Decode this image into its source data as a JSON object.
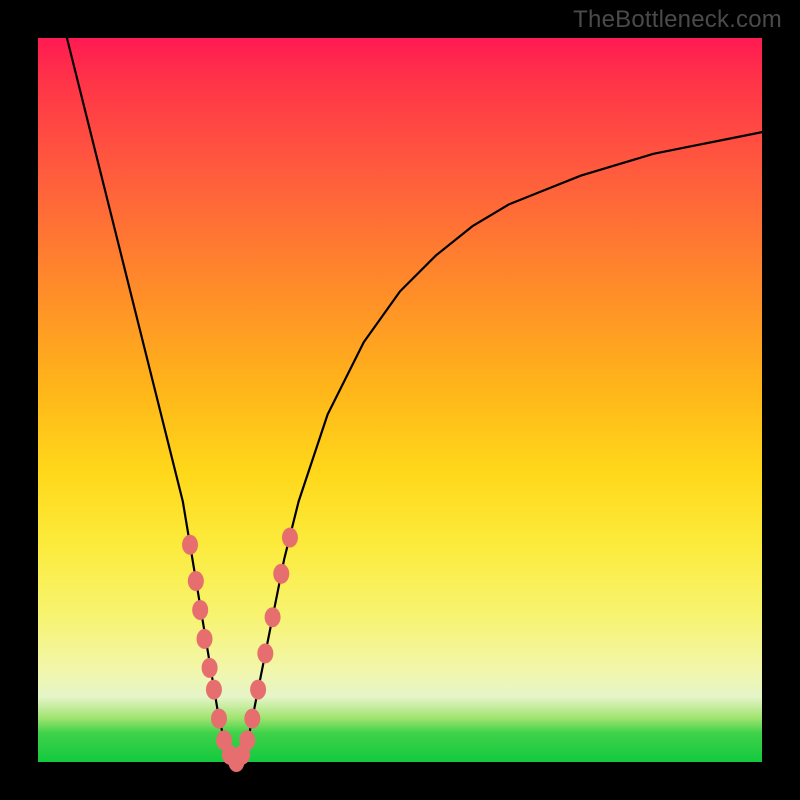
{
  "watermark": "TheBottleneck.com",
  "colors": {
    "frame": "#000000",
    "curve_stroke": "#000000",
    "marker_fill": "#e76e6e",
    "marker_stroke": "#c94f4f",
    "gradient_stops": [
      "#ff1a52",
      "#ff5a3e",
      "#ffb41a",
      "#fceb3c",
      "#f2f6a8",
      "#13c93e"
    ]
  },
  "chart_data": {
    "type": "line",
    "title": "",
    "xlabel": "",
    "ylabel": "",
    "xlim": [
      0,
      100
    ],
    "ylim": [
      0,
      100
    ],
    "grid": false,
    "legend": false,
    "note": "Axes estimated from plot-area proportions; no tick labels are shown in the image. x and y are percent of plot width/height with origin at bottom-left. The curve is a sharp V/valley bottoming near x≈27.",
    "series": [
      {
        "name": "bottleneck-curve",
        "x": [
          4,
          6,
          8,
          10,
          12,
          14,
          16,
          18,
          20,
          22,
          24,
          25,
          26,
          27,
          28,
          29,
          30,
          32,
          34,
          36,
          40,
          45,
          50,
          55,
          60,
          65,
          70,
          75,
          80,
          85,
          90,
          95,
          100
        ],
        "y": [
          100,
          92,
          84,
          76,
          68,
          60,
          52,
          44,
          36,
          24,
          12,
          6,
          2,
          0,
          1,
          3,
          8,
          18,
          28,
          36,
          48,
          58,
          65,
          70,
          74,
          77,
          79,
          81,
          82.5,
          84,
          85,
          86,
          87
        ]
      }
    ],
    "markers": {
      "name": "highlighted-points",
      "note": "Pink rounded markers clustered near the valley on both branches.",
      "points": [
        {
          "x": 21.0,
          "y": 30.0
        },
        {
          "x": 21.8,
          "y": 25.0
        },
        {
          "x": 22.4,
          "y": 21.0
        },
        {
          "x": 23.0,
          "y": 17.0
        },
        {
          "x": 23.7,
          "y": 13.0
        },
        {
          "x": 24.3,
          "y": 10.0
        },
        {
          "x": 25.0,
          "y": 6.0
        },
        {
          "x": 25.7,
          "y": 3.0
        },
        {
          "x": 26.5,
          "y": 1.0
        },
        {
          "x": 27.4,
          "y": 0.0
        },
        {
          "x": 28.2,
          "y": 1.0
        },
        {
          "x": 28.9,
          "y": 3.0
        },
        {
          "x": 29.6,
          "y": 6.0
        },
        {
          "x": 30.4,
          "y": 10.0
        },
        {
          "x": 31.4,
          "y": 15.0
        },
        {
          "x": 32.4,
          "y": 20.0
        },
        {
          "x": 33.6,
          "y": 26.0
        },
        {
          "x": 34.8,
          "y": 31.0
        }
      ]
    }
  }
}
